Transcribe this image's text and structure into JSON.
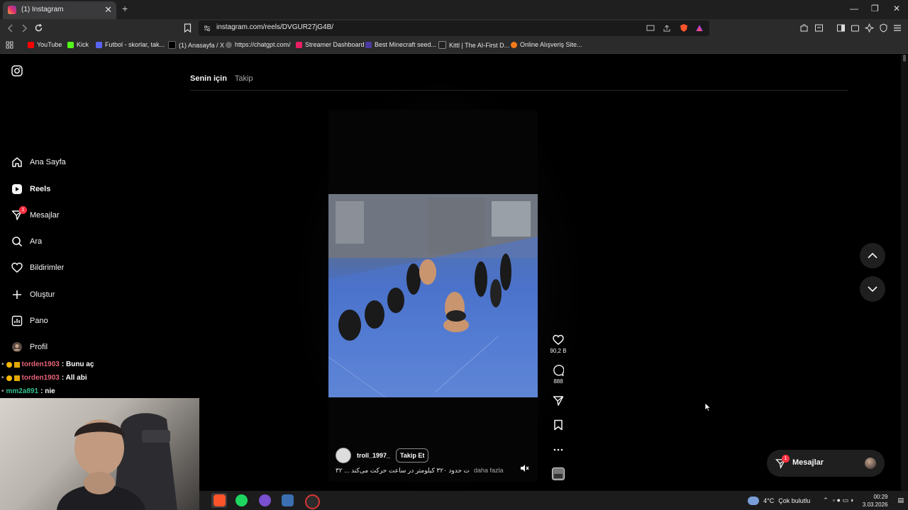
{
  "browser": {
    "tab_title": "(1) Instagram",
    "tab_close": "✕",
    "new_tab": "+",
    "url": "instagram.com/reels/DVGUR27jG4B/",
    "window_controls": [
      "—",
      "❐",
      "✕"
    ],
    "bookmarks": [
      {
        "label": "YouTube",
        "color": "#ff0000"
      },
      {
        "label": "Kick",
        "color": "#53fc18"
      },
      {
        "label": "Futbol - skorlar, tak...",
        "color": "#5865f2"
      },
      {
        "label": "(1) Anasayfa / X",
        "color": "#000000"
      },
      {
        "label": "https://chatgpt.com/",
        "color": "#666666"
      },
      {
        "label": "Streamer Dashboard",
        "color": "#e91e63"
      },
      {
        "label": "Best Minecraft seed...",
        "color": "#4a3aa0"
      },
      {
        "label": "Kittl | The AI-First D...",
        "color": "#222222"
      },
      {
        "label": "Online Alışveriş Site...",
        "color": "#f27a1a"
      }
    ]
  },
  "sidebar": {
    "items": [
      {
        "label": "Ana Sayfa",
        "icon": "home-icon"
      },
      {
        "label": "Reels",
        "icon": "reels-icon"
      },
      {
        "label": "Mesajlar",
        "icon": "messages-icon",
        "badge": "1"
      },
      {
        "label": "Ara",
        "icon": "search-icon"
      },
      {
        "label": "Bildirimler",
        "icon": "heart-icon"
      },
      {
        "label": "Oluştur",
        "icon": "plus-icon"
      },
      {
        "label": "Pano",
        "icon": "chart-icon"
      },
      {
        "label": "Profil",
        "icon": "profile-icon"
      }
    ]
  },
  "feed_tabs": {
    "for_you": "Senin için",
    "following": "Takip"
  },
  "reel": {
    "username": "troll_1997_",
    "follow_label": "Takip Et",
    "caption": "ت حدود ۳۲۰ کیلومتر در ساعت حرکت می‌کند ... ۳۲",
    "more_label": "daha fazla",
    "likes": "90,2 B",
    "comments": "888"
  },
  "messages_pill": {
    "label": "Mesajlar",
    "badge": "1"
  },
  "chat": [
    {
      "user": "torden1903",
      "text": ": Bunu aç",
      "color": "#e8637a"
    },
    {
      "user": "torden1903",
      "text": ": All abi",
      "color": "#e8637a"
    },
    {
      "user": "mm2a891",
      "text": ": nie",
      "color": "#32c08c"
    }
  ],
  "taskbar": {
    "weather_temp": "4°C",
    "weather_text": "Çok bulutlu",
    "time": "00:29",
    "date": "3.03.2026"
  }
}
